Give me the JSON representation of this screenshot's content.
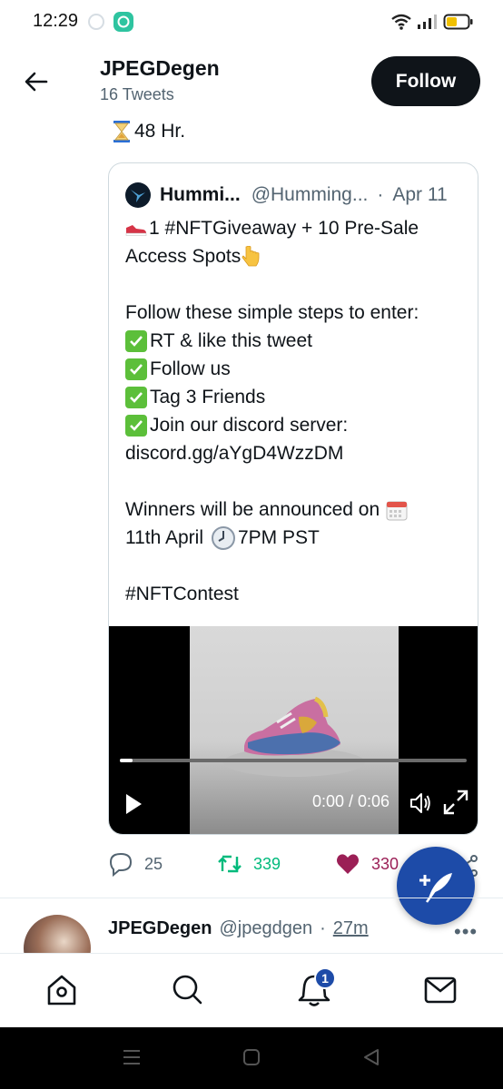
{
  "status_bar": {
    "time": "12:29",
    "icons": [
      "notification-app-icon",
      "wifi-icon",
      "signal-icon",
      "battery-icon"
    ]
  },
  "header": {
    "title": "JPEGDegen",
    "subtitle": "16 Tweets",
    "follow_label": "Follow"
  },
  "tweet": {
    "timer_text": "48 Hr."
  },
  "quoted_tweet": {
    "name": "Hummi...",
    "handle": "@Humming...",
    "separator": "·",
    "date": "Apr 11",
    "lines": {
      "l1": "1 #NFTGiveaway + 10 Pre-Sale",
      "l2": "Access Spots",
      "l3": "Follow these simple steps to enter:",
      "l4": "RT & like this tweet",
      "l5": "Follow us",
      "l6": "Tag 3 Friends",
      "l7": "Join our discord server:",
      "l8": "discord.gg/aYgD4WzzDM",
      "l9": "Winners will be announced on",
      "l10a": "11th April",
      "l10b": "7PM PST",
      "l11": "#NFTContest"
    },
    "video": {
      "time": "0:00 / 0:06",
      "progress_fraction": 0.0
    }
  },
  "actions": {
    "reply_count": "25",
    "retweet_count": "339",
    "like_count": "330",
    "retweet_color": "#00ba7c",
    "like_color": "#f91880"
  },
  "next_tweet": {
    "name": "JPEGDegen",
    "handle": "@jpegdgen",
    "separator": "·",
    "time": "27m",
    "more": "•••"
  },
  "bottom_nav": {
    "items": [
      "home-icon",
      "search-icon",
      "notifications-icon",
      "messages-icon"
    ],
    "notification_badge": "1"
  },
  "colors": {
    "accent": "#1d4ba8",
    "text_primary": "#0f1419",
    "text_secondary": "#536471"
  }
}
